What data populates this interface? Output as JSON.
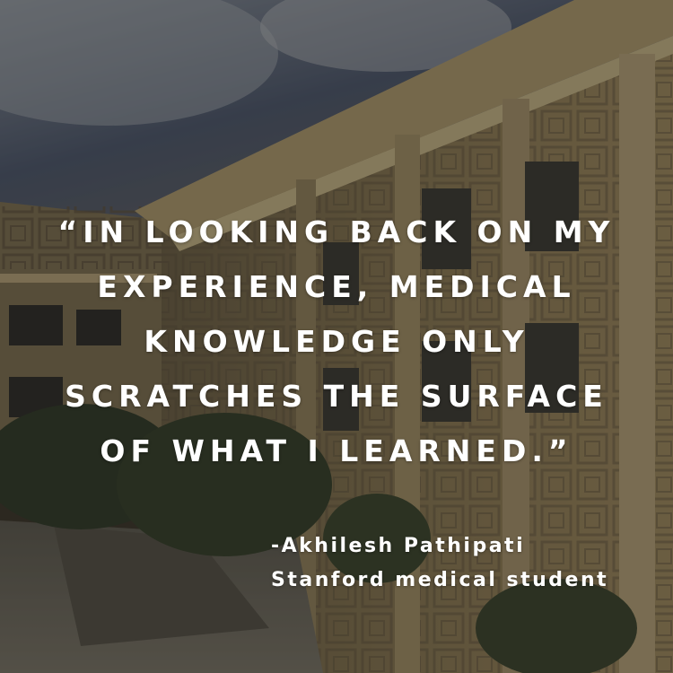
{
  "quote": {
    "lines": [
      "“IN LOOKING BACK ON MY",
      "EXPERIENCE, MEDICAL",
      "KNOWLEDGE ONLY",
      "SCRATCHES THE SURFACE",
      "OF WHAT I LEARNED.”"
    ]
  },
  "attribution": {
    "name": "-Akhilesh Pathipati",
    "role": "Stanford medical student"
  },
  "colors": {
    "text": "#ffffff",
    "sky": "#5b6575",
    "building": "#8f7f5c"
  }
}
